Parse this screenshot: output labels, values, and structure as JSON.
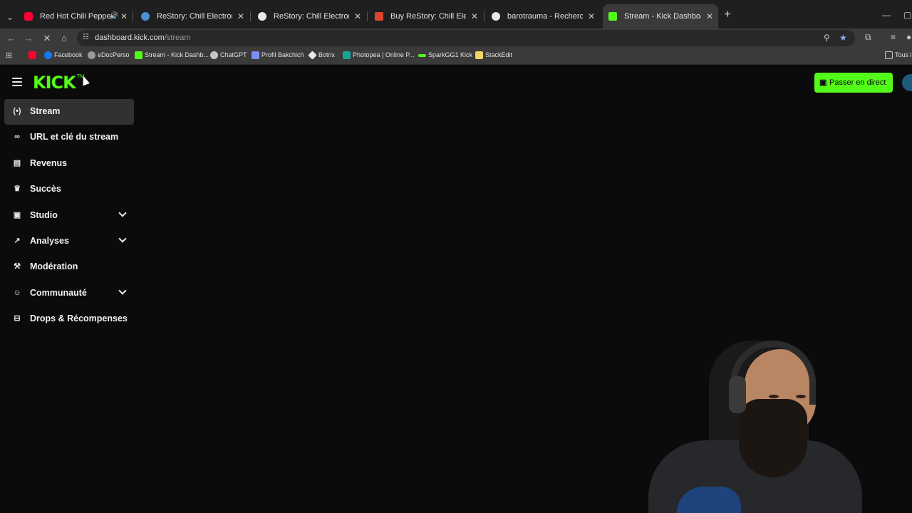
{
  "browser": {
    "tabs": [
      {
        "title": "Red Hot Chili Peppers - Ca",
        "favicon_color": "#ff0033",
        "audio": true,
        "active": false
      },
      {
        "title": "ReStory: Chill Electronics Repair",
        "favicon_color": "#4a90d9",
        "audio": false,
        "active": false
      },
      {
        "title": "ReStory: Chill Electronics Repair",
        "favicon_color": "#e8e8e8",
        "audio": false,
        "active": false
      },
      {
        "title": "Buy ReStory: Chill Electronics R",
        "favicon_color": "#e0442f",
        "audio": false,
        "active": false
      },
      {
        "title": "barotrauma - Recherche Google",
        "favicon_color": "#e8e8e8",
        "audio": false,
        "active": false
      },
      {
        "title": "Stream - Kick Dashboard",
        "favicon_color": "#53fc18",
        "audio": false,
        "active": true
      }
    ],
    "url_host": "dashboard.kick.com",
    "url_path": "/stream",
    "bookmarks": [
      {
        "label": "",
        "icon": "youtube-icon",
        "color": "#ff0033"
      },
      {
        "label": "Facebook",
        "icon": "facebook-icon",
        "color": "#1877f2"
      },
      {
        "label": "eDocPerso",
        "icon": "edoc-icon",
        "color": "#9a9a9a"
      },
      {
        "label": "Stream - Kick Dashb...",
        "icon": "kick-icon",
        "color": "#53fc18"
      },
      {
        "label": "ChatGPT",
        "icon": "chatgpt-icon",
        "color": "#c7c7c7"
      },
      {
        "label": "Profil Bakchich",
        "icon": "bakchich-icon",
        "color": "#7c8cf0"
      },
      {
        "label": "Botrix",
        "icon": "botrix-icon",
        "color": "#e8e8e8"
      },
      {
        "label": "Photopea | Online P...",
        "icon": "photopea-icon",
        "color": "#18a497"
      },
      {
        "label": "SparkGG1 Kick",
        "icon": "spark-icon",
        "color": "#53fc18"
      },
      {
        "label": "StackEdit",
        "icon": "stackedit-icon",
        "color": "#f3d26b"
      }
    ],
    "bookmarks_folder": "Tous l"
  },
  "kick": {
    "logo_text": "KICK",
    "logo_tm": "TM",
    "go_live_label": "Passer en direct",
    "accent_color": "#53fc18",
    "nav": [
      {
        "label": "Stream",
        "icon": "broadcast-icon",
        "active": true,
        "expandable": false
      },
      {
        "label": "URL et clé du stream",
        "icon": "link-icon",
        "active": false,
        "expandable": false
      },
      {
        "label": "Revenus",
        "icon": "revenue-icon",
        "active": false,
        "expandable": false
      },
      {
        "label": "Succès",
        "icon": "trophy-icon",
        "active": false,
        "expandable": false
      },
      {
        "label": "Studio",
        "icon": "studio-icon",
        "active": false,
        "expandable": true
      },
      {
        "label": "Analyses",
        "icon": "analytics-icon",
        "active": false,
        "expandable": true
      },
      {
        "label": "Modération",
        "icon": "wrench-icon",
        "active": false,
        "expandable": false
      },
      {
        "label": "Communauté",
        "icon": "community-icon",
        "active": false,
        "expandable": true
      },
      {
        "label": "Drops & Récompenses",
        "icon": "drops-icon",
        "active": false,
        "expandable": false
      }
    ]
  }
}
